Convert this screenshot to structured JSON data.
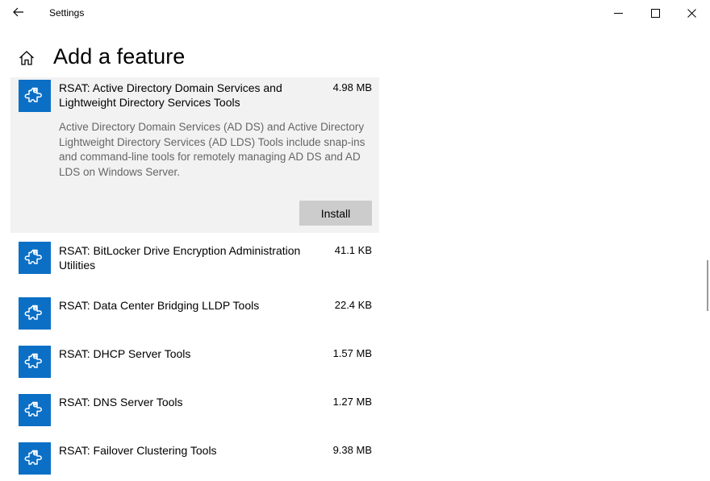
{
  "window": {
    "app_title": "Settings",
    "back_icon": "arrow-left-icon",
    "controls": [
      "minimize-icon",
      "maximize-icon",
      "close-icon"
    ]
  },
  "header": {
    "title": "Add a feature",
    "home_icon": "home-icon"
  },
  "features": [
    {
      "name": "RSAT: Active Directory Domain Services and Lightweight Directory Services Tools",
      "size": "4.98 MB",
      "description": "Active Directory Domain Services (AD DS) and Active Directory Lightweight Directory Services (AD LDS) Tools include snap-ins and command-line tools for remotely managing AD DS and AD LDS on Windows Server.",
      "action_label": "Install",
      "expanded": true
    },
    {
      "name": "RSAT: BitLocker Drive Encryption Administration Utilities",
      "size": "41.1 KB"
    },
    {
      "name": "RSAT: Data Center Bridging LLDP Tools",
      "size": "22.4 KB"
    },
    {
      "name": "RSAT: DHCP Server Tools",
      "size": "1.57 MB"
    },
    {
      "name": "RSAT: DNS Server Tools",
      "size": "1.27 MB"
    },
    {
      "name": "RSAT: Failover Clustering Tools",
      "size": "9.38 MB"
    }
  ],
  "colors": {
    "tile": "#0b6fc5",
    "expanded_bg": "#f2f2f2",
    "button_bg": "#cccccc",
    "description": "#666666"
  },
  "icons": {
    "feature": "puzzle-piece-icon"
  }
}
